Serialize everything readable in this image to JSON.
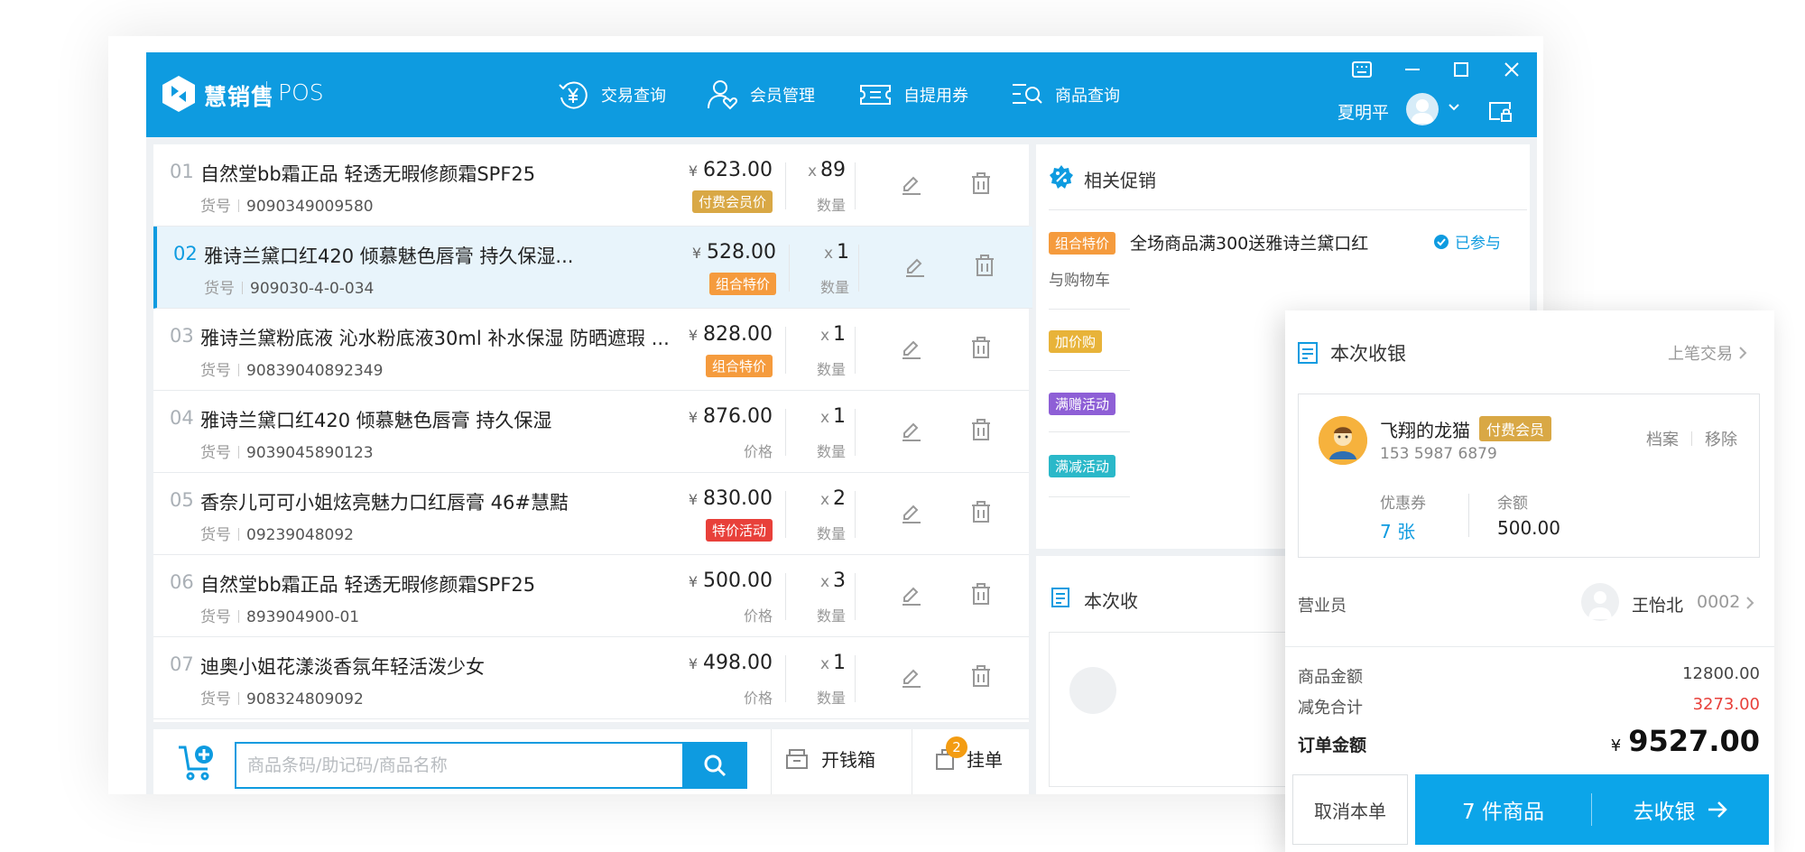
{
  "header": {
    "brand": "慧销售",
    "product": "POS",
    "nav": [
      {
        "label": "交易查询",
        "icon": "yen-clock-icon"
      },
      {
        "label": "会员管理",
        "icon": "member-heart-icon"
      },
      {
        "label": "自提用券",
        "icon": "coupon-ticket-icon"
      },
      {
        "label": "商品查询",
        "icon": "list-search-icon"
      }
    ],
    "user": "夏明平",
    "colors": {
      "primary": "#0e9be0",
      "accent": "#f39c12"
    }
  },
  "items": [
    {
      "no": "01",
      "name": "自然堂bb霜正品 轻透无暇修颜霜SPF25",
      "sku_label": "货号",
      "sku": "9090349009580",
      "price_symbol": "¥",
      "price": "623.00",
      "tag": "付费会员价",
      "tag_color": "#d9a845",
      "qty_prefix": "x",
      "qty": "89",
      "qty_label": "数量"
    },
    {
      "no": "02",
      "name": "雅诗兰黛口红420 倾慕魅色唇膏 持久保湿...",
      "sku_label": "货号",
      "sku": "909030-4-0-034",
      "price_symbol": "¥",
      "price": "528.00",
      "tag": "组合特价",
      "tag_color": "#f59b3d",
      "qty_prefix": "x",
      "qty": "1",
      "qty_label": "数量"
    },
    {
      "no": "03",
      "name": "雅诗兰黛粉底液 沁水粉底液30ml 补水保湿 防晒遮瑕 ...",
      "sku_label": "货号",
      "sku": "90839040892349",
      "price_symbol": "¥",
      "price": "828.00",
      "tag": "组合特价",
      "tag_color": "#f59b3d",
      "qty_prefix": "x",
      "qty": "1",
      "qty_label": "数量"
    },
    {
      "no": "04",
      "name": "雅诗兰黛口红420 倾慕魅色唇膏 持久保湿",
      "sku_label": "货号",
      "sku": "9039045890123",
      "price_symbol": "¥",
      "price": "876.00",
      "price_label": "价格",
      "qty_prefix": "x",
      "qty": "1",
      "qty_label": "数量"
    },
    {
      "no": "05",
      "name": "香奈儿可可小姐炫亮魅力口红唇膏 46#慧黠",
      "sku_label": "货号",
      "sku": "09239048092",
      "price_symbol": "¥",
      "price": "830.00",
      "tag": "特价活动",
      "tag_color": "#e8403a",
      "qty_prefix": "x",
      "qty": "2",
      "qty_label": "数量"
    },
    {
      "no": "06",
      "name": "自然堂bb霜正品 轻透无暇修颜霜SPF25",
      "sku_label": "货号",
      "sku": "893904900-01",
      "price_symbol": "¥",
      "price": "500.00",
      "price_label": "价格",
      "qty_prefix": "x",
      "qty": "3",
      "qty_label": "数量"
    },
    {
      "no": "07",
      "name": "迪奥小姐花漾淡香氛年轻活泼少女",
      "sku_label": "货号",
      "sku": "908324809092",
      "price_symbol": "¥",
      "price": "498.00",
      "price_label": "价格",
      "qty_prefix": "x",
      "qty": "1",
      "qty_label": "数量"
    }
  ],
  "bottom": {
    "search_placeholder": "商品条码/助记码/商品名称",
    "drawer": "开钱箱",
    "hold": "挂单",
    "hold_count": "2"
  },
  "promo": {
    "title": "相关促销",
    "main_tag": "组合特价",
    "main_text": "全场商品满300送雅诗兰黛口红",
    "joined": "已参与",
    "sub_text": "与购物车",
    "tags": [
      {
        "label": "加价购",
        "color": "#e8b339"
      },
      {
        "label": "满赠活动",
        "color": "#8e5fd6"
      },
      {
        "label": "满减活动",
        "color": "#2ab8c9"
      }
    ],
    "second_title": "本次收"
  },
  "checkout": {
    "title": "本次收银",
    "last": "上笔交易",
    "member": {
      "name": "飞翔的龙猫",
      "badge": "付费会员",
      "phone": "153 5987 6879",
      "file": "档案",
      "remove": "移除",
      "coupon_label": "优惠券",
      "coupon_value": "7 张",
      "balance_label": "余额",
      "balance_value": "500.00"
    },
    "clerk_label": "营业员",
    "clerk_name": "王怡北",
    "clerk_id": "0002",
    "goods_label": "商品金额",
    "goods_value": "12800.00",
    "discount_label": "减免合计",
    "discount_value": "3273.00",
    "total_label": "订单金额",
    "total_symbol": "¥",
    "total_value": "9527.00",
    "cancel": "取消本单",
    "count": "7 件商品",
    "go": "去收银"
  }
}
